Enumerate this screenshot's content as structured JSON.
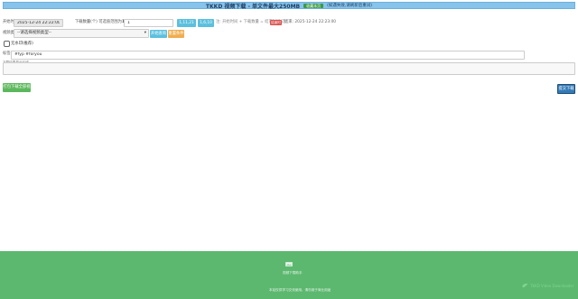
{
  "banner": {
    "title": "TKKD 视频下载 - 单文件最大250MB",
    "button_label": "收藏本页",
    "note": "(如遇失败,请刷新后重试)"
  },
  "form": {
    "start_time_label": "开始时间",
    "start_time_value": "2025-12-24 22:22:00",
    "count_label": "下载数量(个) 可选值范围为1,10,20",
    "count_label_prefix": "下载数量(个) 可选值范围为",
    "count_label_values": "1,10,20",
    "count_value": "1",
    "btn_option_a": "1,11,21",
    "btn_option_b": "1,6,10",
    "hint": "注: 开始时间 + 下载数量 = 结束时间(选)",
    "warn_badge": "结束时间",
    "end_time_text": "结束: 2025-12-24 22:23:00",
    "type_label": "视频类型",
    "type_select_value": "--请选择视频类型--",
    "btn_query": "开始查询",
    "btn_reset": "重置条件",
    "checkbox_label": "无水印(推荐)",
    "tag_label": "标签值",
    "tag_value": "#fyp #foryou",
    "result_label": "下载结果显示区域",
    "btn_left_green": "打包下载全部视频",
    "btn_right_navy": "提交下载"
  },
  "footer": {
    "logo_alt": "logo",
    "caption": "视频下载助手",
    "copyright": "本站仅供学习交流使用，请勿用于商业用途",
    "watermark": "TKKD Video Downloader"
  },
  "colors": {
    "banner_bg": "#87c3ea",
    "footer_bg": "#5cb86f",
    "btn_blue": "#5bc0de",
    "btn_orange": "#f0ad4e",
    "btn_red": "#d9534f",
    "btn_green": "#5cb85c",
    "btn_navy": "#337ab7"
  }
}
